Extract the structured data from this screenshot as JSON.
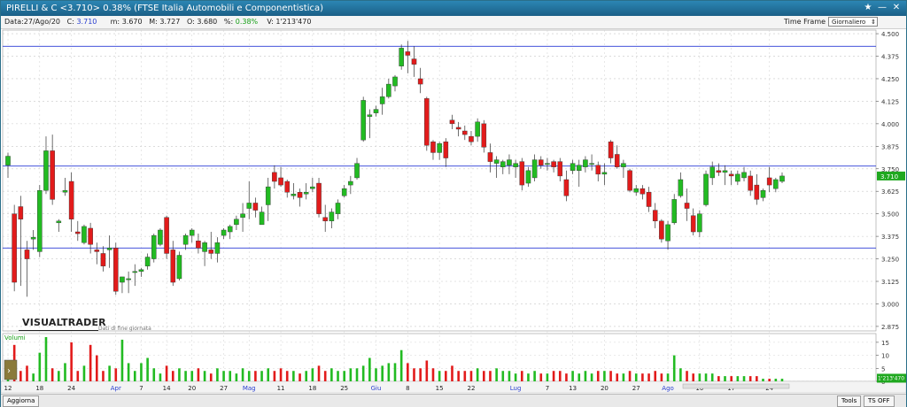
{
  "window": {
    "title": "PIRELLI & C <3.710> 0.38%  (FTSE Italia Automobili e Componentistica)",
    "buttons": [
      "★",
      "—",
      "✕"
    ]
  },
  "infobar": {
    "date_label": "Data:",
    "date": "27/Ago/20",
    "close_label": "C:",
    "close": "3.710",
    "low_label": "m:",
    "low": "3.670",
    "high_label": "M:",
    "high": "3.727",
    "open_label": "O:",
    "open": "3.680",
    "pct_label": "%:",
    "pct": "0.38%",
    "vol_label": "V:",
    "vol": "1'213'470",
    "timeframe_label": "Time Frame",
    "timeframe_value": "Giornaliero"
  },
  "logo": {
    "text": "VISUALTRADER",
    "subtext": "Dati di fine giornata"
  },
  "bottombar": {
    "refresh": "Aggiorna",
    "tools": "Tools",
    "ts_off": "TS OFF"
  },
  "colors": {
    "up": "#22bb22",
    "down": "#e21b1b",
    "hline": "#2b3bd6",
    "last": "#1fa81f"
  },
  "chart_data": {
    "type": "candlestick",
    "price_axis": {
      "min": 2.85,
      "max": 4.52,
      "ticks": [
        "4.500",
        "4.375",
        "4.250",
        "4.125",
        "4.000",
        "3.875",
        "3.750",
        "3.625",
        "3.500",
        "3.375",
        "3.250",
        "3.125",
        "3.000",
        "2.875"
      ]
    },
    "volume_axis": {
      "label": "Volumi",
      "max": 17,
      "ticks": [
        "15",
        "10",
        "5",
        "0"
      ]
    },
    "last_price_label": "3.710",
    "last_volume_label": "1'213'470",
    "horizontal_lines": [
      4.43,
      3.765,
      3.31
    ],
    "x_ticks": [
      {
        "i": 0,
        "label": "12"
      },
      {
        "i": 5,
        "label": "18"
      },
      {
        "i": 10,
        "label": "24"
      },
      {
        "i": 17,
        "label": "Apr"
      },
      {
        "i": 21,
        "label": "7"
      },
      {
        "i": 25,
        "label": "14"
      },
      {
        "i": 29,
        "label": "20"
      },
      {
        "i": 34,
        "label": "27"
      },
      {
        "i": 38,
        "label": "Mag"
      },
      {
        "i": 43,
        "label": "11"
      },
      {
        "i": 48,
        "label": "18"
      },
      {
        "i": 53,
        "label": "25"
      },
      {
        "i": 58,
        "label": "Giu"
      },
      {
        "i": 63,
        "label": "8"
      },
      {
        "i": 68,
        "label": "15"
      },
      {
        "i": 73,
        "label": "22"
      },
      {
        "i": 80,
        "label": "Lug"
      },
      {
        "i": 85,
        "label": "7"
      },
      {
        "i": 89,
        "label": "13"
      },
      {
        "i": 94,
        "label": "20"
      },
      {
        "i": 99,
        "label": "27"
      },
      {
        "i": 104,
        "label": "Ago"
      },
      {
        "i": 109,
        "label": "10"
      },
      {
        "i": 114,
        "label": "17"
      },
      {
        "i": 120,
        "label": "24"
      }
    ],
    "ohlc": [
      [
        3.77,
        3.84,
        3.7,
        3.82
      ],
      [
        3.5,
        3.55,
        3.07,
        3.12
      ],
      [
        3.54,
        3.6,
        3.1,
        3.47
      ],
      [
        3.3,
        3.35,
        3.04,
        3.25
      ],
      [
        3.36,
        3.41,
        3.3,
        3.37
      ],
      [
        3.29,
        3.66,
        3.26,
        3.63
      ],
      [
        3.63,
        3.93,
        3.61,
        3.85
      ],
      [
        3.85,
        3.94,
        3.55,
        3.58
      ],
      [
        3.45,
        3.47,
        3.4,
        3.46
      ],
      [
        3.62,
        3.7,
        3.6,
        3.63
      ],
      [
        3.68,
        3.73,
        3.4,
        3.47
      ],
      [
        3.4,
        3.46,
        3.35,
        3.39
      ],
      [
        3.34,
        3.44,
        3.33,
        3.43
      ],
      [
        3.42,
        3.45,
        3.28,
        3.33
      ],
      [
        3.3,
        3.34,
        3.22,
        3.29
      ],
      [
        3.28,
        3.32,
        3.18,
        3.21
      ],
      [
        3.3,
        3.38,
        3.2,
        3.31
      ],
      [
        3.31,
        3.34,
        3.05,
        3.07
      ],
      [
        3.12,
        3.15,
        3.06,
        3.15
      ],
      [
        3.14,
        3.18,
        3.06,
        3.14
      ],
      [
        3.18,
        3.22,
        3.1,
        3.18
      ],
      [
        3.18,
        3.2,
        3.15,
        3.19
      ],
      [
        3.21,
        3.28,
        3.19,
        3.26
      ],
      [
        3.25,
        3.39,
        3.23,
        3.38
      ],
      [
        3.33,
        3.42,
        3.32,
        3.41
      ],
      [
        3.48,
        3.49,
        3.25,
        3.28
      ],
      [
        3.3,
        3.35,
        3.1,
        3.12
      ],
      [
        3.14,
        3.29,
        3.13,
        3.27
      ],
      [
        3.33,
        3.39,
        3.3,
        3.38
      ],
      [
        3.38,
        3.42,
        3.34,
        3.41
      ],
      [
        3.35,
        3.39,
        3.28,
        3.31
      ],
      [
        3.29,
        3.35,
        3.21,
        3.34
      ],
      [
        3.3,
        3.4,
        3.25,
        3.28
      ],
      [
        3.28,
        3.37,
        3.23,
        3.34
      ],
      [
        3.38,
        3.42,
        3.36,
        3.41
      ],
      [
        3.4,
        3.44,
        3.36,
        3.43
      ],
      [
        3.44,
        3.49,
        3.41,
        3.47
      ],
      [
        3.48,
        3.56,
        3.4,
        3.5
      ],
      [
        3.53,
        3.68,
        3.47,
        3.56
      ],
      [
        3.56,
        3.59,
        3.48,
        3.52
      ],
      [
        3.44,
        3.54,
        3.44,
        3.51
      ],
      [
        3.55,
        3.7,
        3.46,
        3.65
      ],
      [
        3.73,
        3.77,
        3.64,
        3.68
      ],
      [
        3.7,
        3.76,
        3.65,
        3.66
      ],
      [
        3.68,
        3.69,
        3.59,
        3.62
      ],
      [
        3.6,
        3.67,
        3.58,
        3.61
      ],
      [
        3.62,
        3.64,
        3.54,
        3.59
      ],
      [
        3.61,
        3.67,
        3.58,
        3.62
      ],
      [
        3.64,
        3.7,
        3.62,
        3.65
      ],
      [
        3.67,
        3.7,
        3.48,
        3.5
      ],
      [
        3.48,
        3.55,
        3.4,
        3.46
      ],
      [
        3.46,
        3.53,
        3.42,
        3.51
      ],
      [
        3.5,
        3.58,
        3.47,
        3.56
      ],
      [
        3.6,
        3.66,
        3.59,
        3.64
      ],
      [
        3.66,
        3.71,
        3.61,
        3.68
      ],
      [
        3.7,
        3.81,
        3.69,
        3.78
      ],
      [
        3.91,
        4.15,
        3.9,
        4.13
      ],
      [
        4.04,
        4.08,
        3.92,
        4.05
      ],
      [
        4.06,
        4.1,
        4.04,
        4.08
      ],
      [
        4.11,
        4.2,
        4.05,
        4.15
      ],
      [
        4.15,
        4.25,
        4.14,
        4.22
      ],
      [
        4.21,
        4.27,
        4.18,
        4.26
      ],
      [
        4.32,
        4.44,
        4.3,
        4.42
      ],
      [
        4.4,
        4.46,
        4.28,
        4.38
      ],
      [
        4.36,
        4.43,
        4.26,
        4.33
      ],
      [
        4.25,
        4.31,
        4.17,
        4.22
      ],
      [
        4.14,
        4.15,
        3.85,
        3.88
      ],
      [
        3.9,
        3.91,
        3.8,
        3.84
      ],
      [
        3.84,
        3.9,
        3.8,
        3.89
      ],
      [
        3.9,
        3.92,
        3.76,
        3.81
      ],
      [
        4.02,
        4.05,
        3.97,
        4.0
      ],
      [
        3.98,
        4.01,
        3.93,
        3.97
      ],
      [
        3.96,
        3.99,
        3.91,
        3.94
      ],
      [
        3.93,
        3.96,
        3.88,
        3.9
      ],
      [
        3.93,
        4.03,
        3.9,
        4.01
      ],
      [
        4.0,
        4.02,
        3.84,
        3.87
      ],
      [
        3.84,
        3.89,
        3.73,
        3.79
      ],
      [
        3.78,
        3.82,
        3.7,
        3.8
      ],
      [
        3.76,
        3.8,
        3.72,
        3.79
      ],
      [
        3.77,
        3.83,
        3.72,
        3.8
      ],
      [
        3.76,
        3.8,
        3.7,
        3.78
      ],
      [
        3.79,
        3.81,
        3.63,
        3.66
      ],
      [
        3.67,
        3.76,
        3.65,
        3.74
      ],
      [
        3.7,
        3.83,
        3.68,
        3.8
      ],
      [
        3.8,
        3.82,
        3.75,
        3.77
      ],
      [
        3.78,
        3.81,
        3.74,
        3.78
      ],
      [
        3.79,
        3.8,
        3.73,
        3.76
      ],
      [
        3.79,
        3.81,
        3.68,
        3.71
      ],
      [
        3.69,
        3.74,
        3.57,
        3.6
      ],
      [
        3.74,
        3.8,
        3.72,
        3.78
      ],
      [
        3.74,
        3.8,
        3.65,
        3.77
      ],
      [
        3.76,
        3.82,
        3.73,
        3.8
      ],
      [
        3.78,
        3.83,
        3.74,
        3.78
      ],
      [
        3.77,
        3.79,
        3.68,
        3.72
      ],
      [
        3.72,
        3.78,
        3.66,
        3.73
      ],
      [
        3.9,
        3.91,
        3.78,
        3.81
      ],
      [
        3.83,
        3.88,
        3.75,
        3.76
      ],
      [
        3.76,
        3.8,
        3.7,
        3.78
      ],
      [
        3.74,
        3.75,
        3.62,
        3.63
      ],
      [
        3.62,
        3.66,
        3.6,
        3.64
      ],
      [
        3.64,
        3.66,
        3.58,
        3.61
      ],
      [
        3.62,
        3.65,
        3.51,
        3.54
      ],
      [
        3.52,
        3.56,
        3.42,
        3.46
      ],
      [
        3.46,
        3.47,
        3.34,
        3.36
      ],
      [
        3.35,
        3.46,
        3.3,
        3.44
      ],
      [
        3.45,
        3.61,
        3.44,
        3.58
      ],
      [
        3.6,
        3.73,
        3.59,
        3.69
      ],
      [
        3.56,
        3.64,
        3.46,
        3.53
      ],
      [
        3.49,
        3.53,
        3.38,
        3.4
      ],
      [
        3.4,
        3.52,
        3.37,
        3.5
      ],
      [
        3.55,
        3.74,
        3.54,
        3.72
      ],
      [
        3.7,
        3.79,
        3.66,
        3.76
      ],
      [
        3.74,
        3.78,
        3.71,
        3.73
      ],
      [
        3.73,
        3.77,
        3.66,
        3.74
      ],
      [
        3.72,
        3.74,
        3.66,
        3.71
      ],
      [
        3.68,
        3.74,
        3.66,
        3.72
      ],
      [
        3.7,
        3.76,
        3.68,
        3.73
      ],
      [
        3.71,
        3.74,
        3.6,
        3.63
      ],
      [
        3.66,
        3.72,
        3.55,
        3.58
      ],
      [
        3.59,
        3.64,
        3.57,
        3.63
      ],
      [
        3.7,
        3.76,
        3.62,
        3.66
      ],
      [
        3.64,
        3.7,
        3.62,
        3.69
      ],
      [
        3.68,
        3.73,
        3.67,
        3.71
      ]
    ],
    "volume": [
      4,
      14,
      4,
      6,
      3,
      11,
      17,
      5,
      4,
      7,
      15,
      4,
      6,
      14,
      10,
      4,
      6,
      5,
      16,
      7,
      4,
      7,
      9,
      5,
      3,
      6,
      4,
      5,
      4,
      4,
      5,
      4,
      3,
      5,
      4,
      4,
      3,
      5,
      4,
      4,
      4,
      5,
      4,
      5,
      4,
      4,
      3,
      4,
      5,
      6,
      4,
      5,
      4,
      4,
      5,
      5,
      6,
      9,
      5,
      6,
      7,
      7,
      12,
      7,
      5,
      5,
      8,
      5,
      4,
      4,
      6,
      4,
      4,
      4,
      5,
      4,
      4,
      5,
      4,
      4,
      3,
      4,
      3,
      4,
      3,
      3,
      4,
      4,
      3,
      4,
      3,
      4,
      3,
      4,
      4,
      4,
      3,
      3,
      4,
      3,
      3,
      3,
      4,
      3,
      3,
      10,
      5,
      4,
      3,
      3,
      3,
      3,
      2,
      2,
      2,
      2,
      2,
      2,
      2,
      1,
      1,
      1,
      1
    ]
  }
}
